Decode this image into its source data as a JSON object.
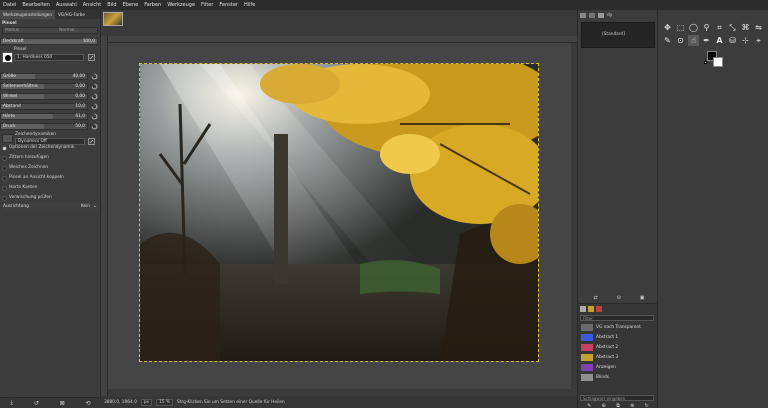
{
  "menu": [
    "Datei",
    "Bearbeiten",
    "Auswahl",
    "Ansicht",
    "Bild",
    "Ebene",
    "Farben",
    "Werkzeuge",
    "Filter",
    "Fenster",
    "Hilfe"
  ],
  "left_tabs": [
    "Werkzeugeinstellungen",
    "VG/HG-Farbe"
  ],
  "tool_title": "Pinsel",
  "mode_label": "Modus",
  "mode_value": "Normal",
  "opacity_label": "Deckkraft",
  "opacity_value": "100,0",
  "brush_label": "Pinsel",
  "brush_name": "1. Hardness 050",
  "sliders": [
    {
      "label": "Größe",
      "value": "40,00",
      "fill": 0.4
    },
    {
      "label": "Seitenverhältnis",
      "value": "0,00",
      "fill": 0.5
    },
    {
      "label": "Winkel",
      "value": "0,00",
      "fill": 0.5
    },
    {
      "label": "Abstand",
      "value": "10,0",
      "fill": 0.1
    },
    {
      "label": "Härte",
      "value": "61,0",
      "fill": 0.61
    },
    {
      "label": "Druck",
      "value": "50,0",
      "fill": 0.5
    }
  ],
  "dynamics_label": "Zeichendynamiken",
  "dynamics_value": "Dynamics Off",
  "options": [
    {
      "label": "Optionen der Zeichendynamik",
      "on": true
    },
    {
      "label": "Zittern hinzufügen",
      "on": false
    },
    {
      "label": "Weiches Zeichnen",
      "on": false
    },
    {
      "label": "Pinsel an Ansicht koppeln",
      "on": false
    },
    {
      "label": "Harte Kanten",
      "on": false
    },
    {
      "label": "Verwischung prüfen",
      "on": false
    }
  ],
  "alignment_label": "Ausrichtung",
  "alignment_value": "Kein",
  "status": {
    "coords": "3880.0, 1964.0",
    "unit": "px",
    "zoom": "15 %",
    "hint": "Strg-Klicken Sie um Setzen einer Quelle für Heilen"
  },
  "histogram_label": "[Standard]",
  "right_tab_label": "dy",
  "brush_filter_placeholder": "Filter",
  "brushes": [
    {
      "name": "VG nach Transparent",
      "color": "#6a6a6a"
    },
    {
      "name": "Abstract 1",
      "color": "#3a5ad8"
    },
    {
      "name": "Abstract 2",
      "color": "#c84060"
    },
    {
      "name": "Abstract 3",
      "color": "#c8a030"
    },
    {
      "name": "Anzeigen",
      "color": "#8040b0"
    },
    {
      "name": "Blinds",
      "color": "#909090"
    }
  ],
  "brush_tag_placeholder": "Schlagwort eingeben",
  "accent_color": "#d8c02a",
  "tools": [
    "move-icon",
    "rect-select-icon",
    "lasso-icon",
    "fuzzy-select-icon",
    "crop-icon",
    "transform-icon",
    "warp-icon",
    "flip-icon",
    "paintbrush-icon",
    "clone-icon",
    "smudge-icon",
    "text-icon",
    "paths-icon",
    "bucket-icon",
    "picker-icon",
    "measure-icon"
  ]
}
